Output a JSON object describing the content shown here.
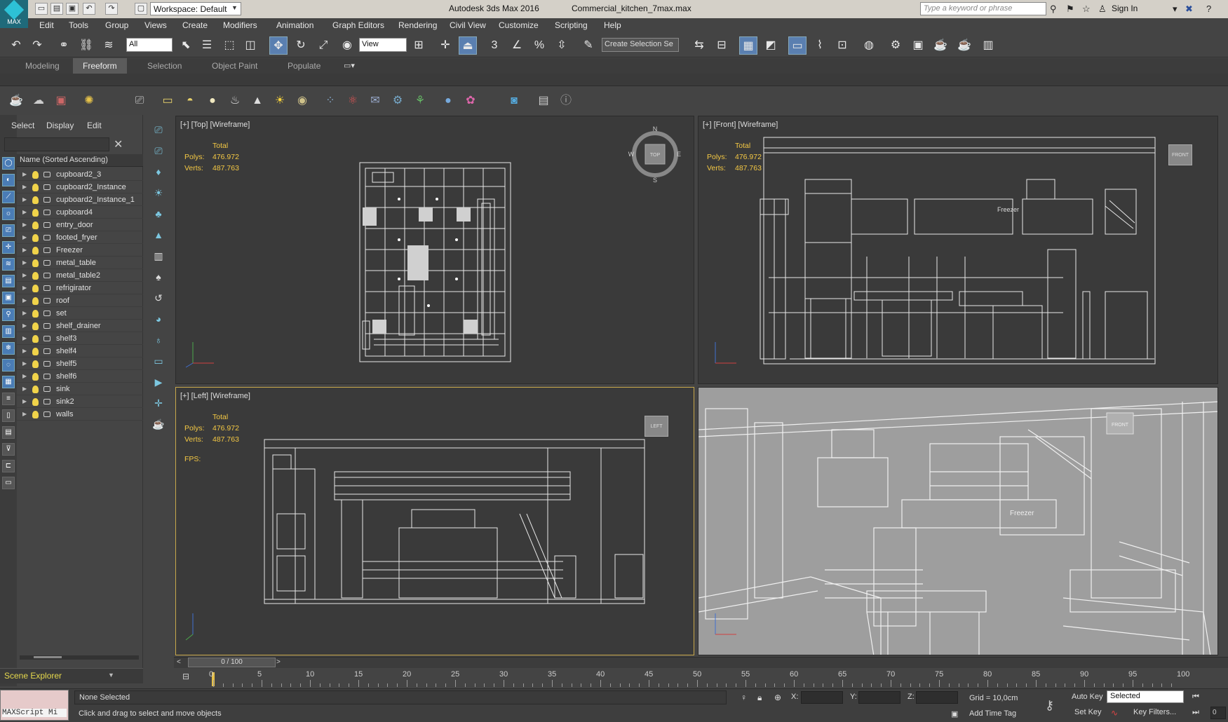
{
  "titlebar": {
    "logo_label": "MAX",
    "workspace": "Workspace: Default",
    "app_title": "Autodesk 3ds Max 2016",
    "file_name": "Commercial_kitchen_7max.max",
    "search_placeholder": "Type a keyword or phrase",
    "sign_in": "Sign In"
  },
  "menu": [
    "Edit",
    "Tools",
    "Group",
    "Views",
    "Create",
    "Modifiers",
    "Animation",
    "Graph Editors",
    "Rendering",
    "Civil View",
    "Customize",
    "Scripting",
    "Help"
  ],
  "maintoolbar": {
    "filter": "All",
    "refcoord": "View",
    "selection_set": "Create Selection Se"
  },
  "ribbon": {
    "tabs": [
      "Modeling",
      "Freeform",
      "Selection",
      "Object Paint",
      "Populate"
    ],
    "active": "Freeform"
  },
  "scene_explorer": {
    "tabs": [
      "Select",
      "Display",
      "Edit"
    ],
    "column_header": "Name (Sorted Ascending)",
    "items": [
      "cupboard2_3",
      "cupboard2_Instance",
      "cupboard2_Instance_1",
      "cupboard4",
      "entry_door",
      "footed_fryer",
      "Freezer",
      "metal_table",
      "metal_table2",
      "refrigirator",
      "roof",
      "set",
      "shelf_drainer",
      "shelf3",
      "shelf4",
      "shelf5",
      "shelf6",
      "sink",
      "sink2",
      "walls"
    ],
    "footer": "Scene Explorer"
  },
  "viewports": {
    "top": {
      "label": "[+] [Top] [Wireframe]",
      "cube": "TOP",
      "compass": [
        "N",
        "E",
        "S",
        "W"
      ]
    },
    "front": {
      "label": "[+] [Front] [Wireframe]",
      "cube": "FRONT"
    },
    "left": {
      "label": "[+] [Left] [Wireframe]",
      "cube": "LEFT",
      "fps": "FPS:"
    },
    "persp": {
      "cube": "FRONT",
      "text": "Freezer"
    },
    "front_text": "Freezer",
    "stats": {
      "total": "Total",
      "polys_label": "Polys:",
      "polys": "476.972",
      "verts_label": "Verts:",
      "verts": "487.763"
    }
  },
  "timeline": {
    "slider": "0 / 100",
    "ticks": [
      "0",
      "5",
      "10",
      "15",
      "20",
      "25",
      "30",
      "35",
      "40",
      "45",
      "50",
      "55",
      "60",
      "65",
      "70",
      "75",
      "80",
      "85",
      "90",
      "95",
      "100"
    ]
  },
  "status": {
    "maxscript": "MAXScript Mi",
    "selection": "None Selected",
    "hint": "Click and drag to select and move objects",
    "x": "X:",
    "y": "Y:",
    "z": "Z:",
    "grid": "Grid = 10,0cm",
    "add_time_tag": "Add Time Tag",
    "auto_key": "Auto Key",
    "set_key": "Set Key",
    "key_mode": "Selected",
    "key_filters": "Key Filters...",
    "frame": "0"
  },
  "colors": {
    "stats": "#f5c944",
    "selected_border": "#c8a84b",
    "active_tool": "#5a7fb0"
  }
}
